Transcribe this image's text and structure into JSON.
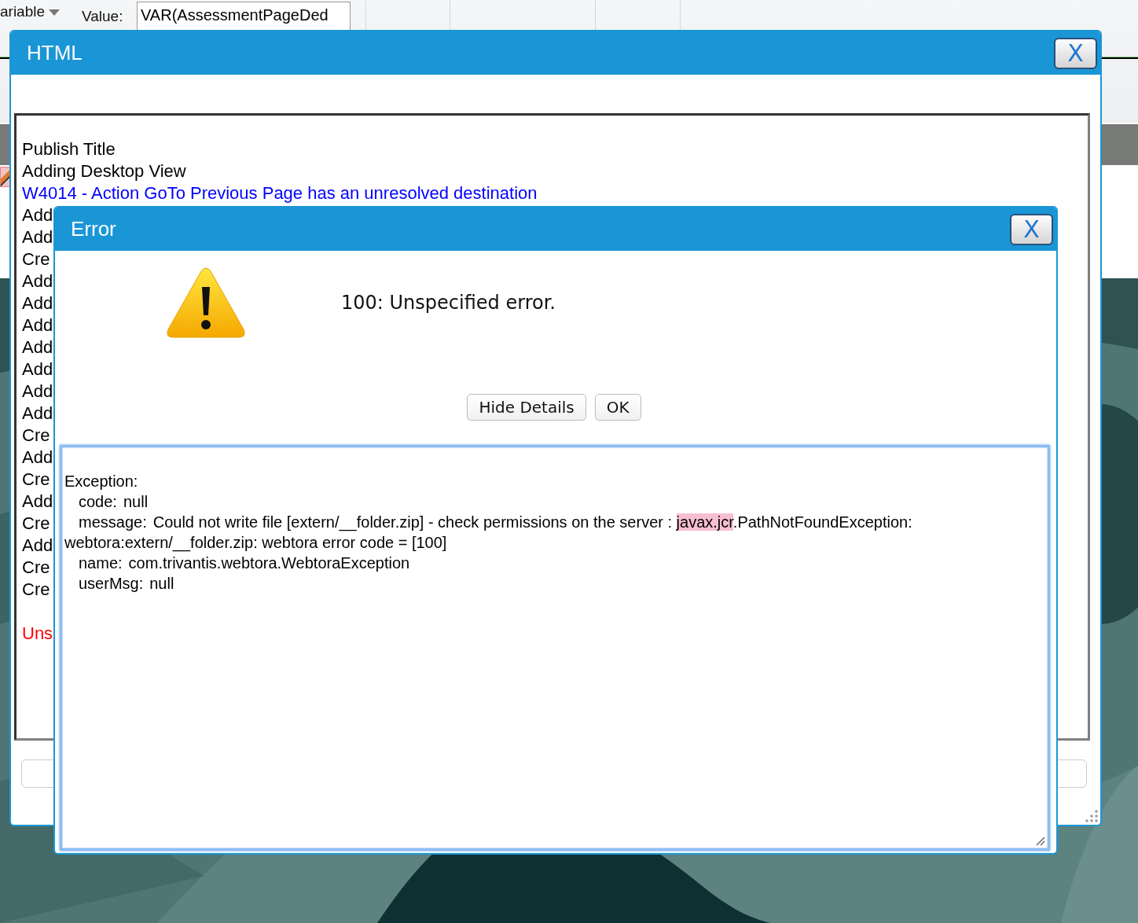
{
  "toolbar": {
    "variable_label": "ariable",
    "value_label": "Value:",
    "value": "VAR(AssessmentPageDed"
  },
  "html_window": {
    "title": "HTML",
    "close": "X",
    "log": [
      {
        "text": "Publish Title",
        "kind": "info"
      },
      {
        "text": "Adding Desktop View",
        "kind": "info"
      },
      {
        "text": "W4014 - Action GoTo Previous Page has an unresolved destination",
        "kind": "warning"
      },
      {
        "text": "Add",
        "kind": "info"
      },
      {
        "text": "Add",
        "kind": "info"
      },
      {
        "text": "Cre",
        "kind": "info"
      },
      {
        "text": "Add",
        "kind": "info"
      },
      {
        "text": "Add",
        "kind": "info"
      },
      {
        "text": "Add",
        "kind": "info"
      },
      {
        "text": "Add",
        "kind": "info"
      },
      {
        "text": "Add",
        "kind": "info"
      },
      {
        "text": "Add",
        "kind": "info"
      },
      {
        "text": "Add",
        "kind": "info"
      },
      {
        "text": "Cre",
        "kind": "info"
      },
      {
        "text": "Add",
        "kind": "info"
      },
      {
        "text": "Cre",
        "kind": "info"
      },
      {
        "text": "Add",
        "kind": "info"
      },
      {
        "text": "Cre",
        "kind": "info"
      },
      {
        "text": "Add",
        "kind": "info"
      },
      {
        "text": "Cre",
        "kind": "info"
      },
      {
        "text": "Cre",
        "kind": "info"
      },
      {
        "text": "Uns",
        "kind": "error"
      }
    ]
  },
  "error_dialog": {
    "title": "Error",
    "close": "X",
    "message": "100: Unspecified error.",
    "buttons": [
      "Hide Details",
      "OK"
    ],
    "details": {
      "heading": "Exception:",
      "fields": [
        {
          "label": "code:",
          "parts": [
            {
              "text": "null",
              "highlighted": false
            }
          ]
        },
        {
          "label": "message:",
          "parts": [
            {
              "text": "Could not write file [extern/__folder.zip] - check permissions on the server : ",
              "highlighted": false
            },
            {
              "text": "javax.jcr",
              "highlighted": true
            },
            {
              "text": ".PathNotFoundException: webtora:extern/__folder.zip: webtora error code = [100]",
              "highlighted": false
            }
          ]
        },
        {
          "label": "name:",
          "parts": [
            {
              "text": "com.trivantis.webtora.WebtoraException",
              "highlighted": false
            }
          ]
        },
        {
          "label": "userMsg:",
          "parts": [
            {
              "text": "null",
              "highlighted": false
            }
          ]
        }
      ]
    }
  }
}
